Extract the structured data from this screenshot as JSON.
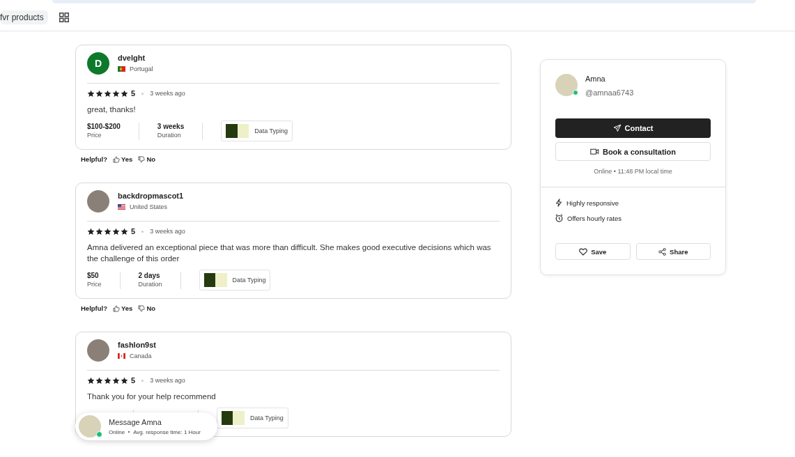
{
  "bookmarks_bar": {
    "bookmark": "fvr products"
  },
  "reviews": [
    {
      "avatar": {
        "kind": "letter",
        "letter": "D"
      },
      "username": "dvelght",
      "flag": {
        "kind": "portugal"
      },
      "country": "Portugal",
      "stars": 5,
      "rating": "5",
      "time": "3 weeks ago",
      "text": "great, thanks!",
      "price": "$100-$200",
      "price_label": "Price",
      "duration": "3 weeks",
      "duration_label": "Duration",
      "gig": "Data Typing",
      "helpful": "Helpful?",
      "yes": "Yes",
      "no": "No"
    },
    {
      "avatar": {
        "kind": "photo"
      },
      "username": "backdropmascot1",
      "flag": {
        "kind": "usa"
      },
      "country": "United States",
      "stars": 5,
      "rating": "5",
      "time": "3 weeks ago",
      "text": "Amna delivered an exceptional piece that was more than difficult. She makes good executive decisions which was the challenge of this order",
      "price": "$50",
      "price_label": "Price",
      "duration": "2 days",
      "duration_label": "Duration",
      "gig": "Data Typing",
      "helpful": "Helpful?",
      "yes": "Yes",
      "no": "No"
    },
    {
      "avatar": {
        "kind": "photo"
      },
      "username": "fashlon9st",
      "flag": {
        "kind": "canada"
      },
      "country": "Canada",
      "stars": 5,
      "rating": "5",
      "time": "3 weeks ago",
      "text": "Thank you for your help recommend",
      "gig": "Data Typing"
    }
  ],
  "seller_card": {
    "name": "Amna",
    "handle": "@amnaa6743",
    "online": true,
    "contact": "Contact",
    "consultation": "Book a consultation",
    "status": "Online • 11:48 PM local time",
    "features": [
      {
        "kind": "bolt",
        "label": "Highly responsive"
      },
      {
        "kind": "clock",
        "label": "Offers hourly rates"
      }
    ],
    "save": "Save",
    "share": "Share"
  },
  "message_popup": {
    "title": "Message Amna",
    "status": "Online",
    "response": "Avg. response time: 1 Hour",
    "online": true
  }
}
